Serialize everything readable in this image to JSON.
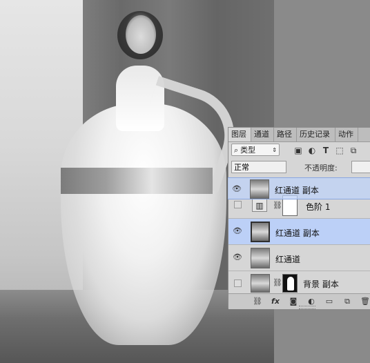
{
  "panel": {
    "tabs": [
      {
        "label": "图层",
        "active": true
      },
      {
        "label": "通道"
      },
      {
        "label": "路径"
      },
      {
        "label": "历史记录"
      },
      {
        "label": "动作"
      }
    ],
    "filter": {
      "value": "类型"
    },
    "filter_icons": [
      "image-filter-icon",
      "adjustment-filter-icon",
      "type-filter-icon",
      "shape-filter-icon",
      "smart-object-filter-icon"
    ],
    "blend_mode": "正常",
    "opacity_label": "不透明度:",
    "layers": [
      {
        "name": "色阶 1",
        "visible": false,
        "type": "adjustment"
      },
      {
        "name": "红通道 副本",
        "visible": true,
        "selected": true
      },
      {
        "name": "红通道",
        "visible": true
      },
      {
        "name": "背景 副本",
        "visible": false,
        "has_mask": true
      }
    ],
    "drag_ghost": {
      "name": "红通道 副本"
    },
    "bottom_icons": [
      "link-icon",
      "fx",
      "add-mask-icon",
      "adjustment-icon",
      "group-icon",
      "new-layer-icon",
      "trash-icon"
    ],
    "colors": {
      "selected": "#bcd0f7",
      "panel_bg": "#d6d6d6"
    }
  }
}
